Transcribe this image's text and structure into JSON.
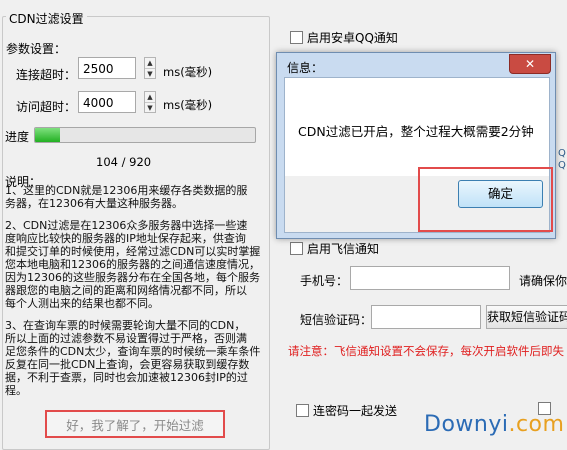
{
  "cdn": {
    "group_title": "CDN过滤设置",
    "params_label": "参数设置：",
    "connect_timeout_label": "连接超时：",
    "connect_timeout_value": "2500",
    "access_timeout_label": "访问超时：",
    "access_timeout_value": "4000",
    "unit": "ms(毫秒)",
    "progress_label": "进度",
    "progress_fraction": 0.113,
    "progress_text": "104 / 920",
    "desc_title": "说明：",
    "desc_lines": [
      "1、这里的CDN就是12306用来缓存各类数据的服",
      "务器，在12306有大量这种服务器。",
      "",
      "2、CDN过滤是在12306众多服务器中选择一些速",
      "度响应比较快的服务器的IP地址保存起来，供查询",
      "和提交订单的时候使用，经常过滤CDN可以实时掌握",
      "您本地电脑和12306的服务器的之间通信速度情况，",
      "因为12306的这些服务器分布在全国各地，每个服务",
      "器跟您的电脑之间的距离和网络情况都不同，所以",
      "每个人测出来的结果也都不同。",
      "",
      "3、在查询车票的时候需要轮询大量不同的CDN，",
      "所以上面的过滤参数不易设置得过于严格，否则满",
      "足您条件的CDN太少，查询车票的时候统一乘车条件",
      "反复在同一批CDN上查询，会更容易获取到缓存数",
      "据，不利于查票，同时也会加速被12306封IP的过",
      "程。"
    ],
    "start_button": "好，我了解了，开始过滤"
  },
  "right": {
    "android_qq": "启用安卓QQ通知",
    "feixin": "启用飞信通知",
    "phone_label": "手机号：",
    "phone_hint": "请确保你",
    "sms_label": "短信验证码：",
    "get_sms_button": "获取短信验证码",
    "warning": "请注意：飞信通知设置不会保存，每次开启软件后即失",
    "send_with_password": "连密码一起发送",
    "edge_q": "Q",
    "edge_q2": "Q"
  },
  "dialog": {
    "title": "信息：",
    "close": "✕",
    "message": "CDN过滤已开启，整个过程大概需要2分钟",
    "ok": "确定"
  },
  "watermark": {
    "main": "Downyi",
    "suffix": ".com"
  }
}
